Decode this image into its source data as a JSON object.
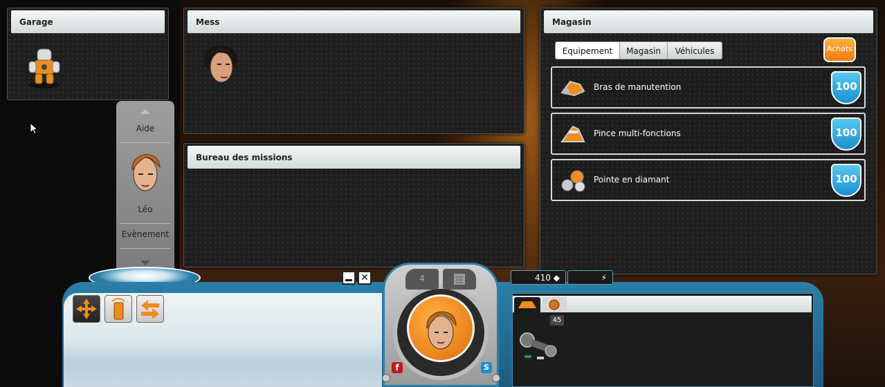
{
  "garage": {
    "title": "Garage"
  },
  "mess": {
    "title": "Mess"
  },
  "bureau": {
    "title": "Bureau des missions"
  },
  "magasin": {
    "title": "Magasin",
    "tabs": [
      {
        "label": "Equipement"
      },
      {
        "label": "Magasin"
      },
      {
        "label": "Véhicules"
      }
    ],
    "achats_label": "Achats",
    "items": [
      {
        "name": "Bras de manutention",
        "price": "100"
      },
      {
        "name": "Pince multi-fonctions",
        "price": "100"
      },
      {
        "name": "Pointe en diamant",
        "price": "100"
      }
    ]
  },
  "menu": {
    "aide": "Aide",
    "character": "Léo",
    "evenement": "Evènement"
  },
  "hud": {
    "chat_count": "4",
    "credits": "410",
    "energy": "",
    "inventory_count": "45",
    "facebook": "f",
    "skype": "S"
  },
  "colors": {
    "accent": "#f08c1e",
    "hud_blue": "#2a7fa8",
    "price_blue": "#1a8fd0"
  }
}
